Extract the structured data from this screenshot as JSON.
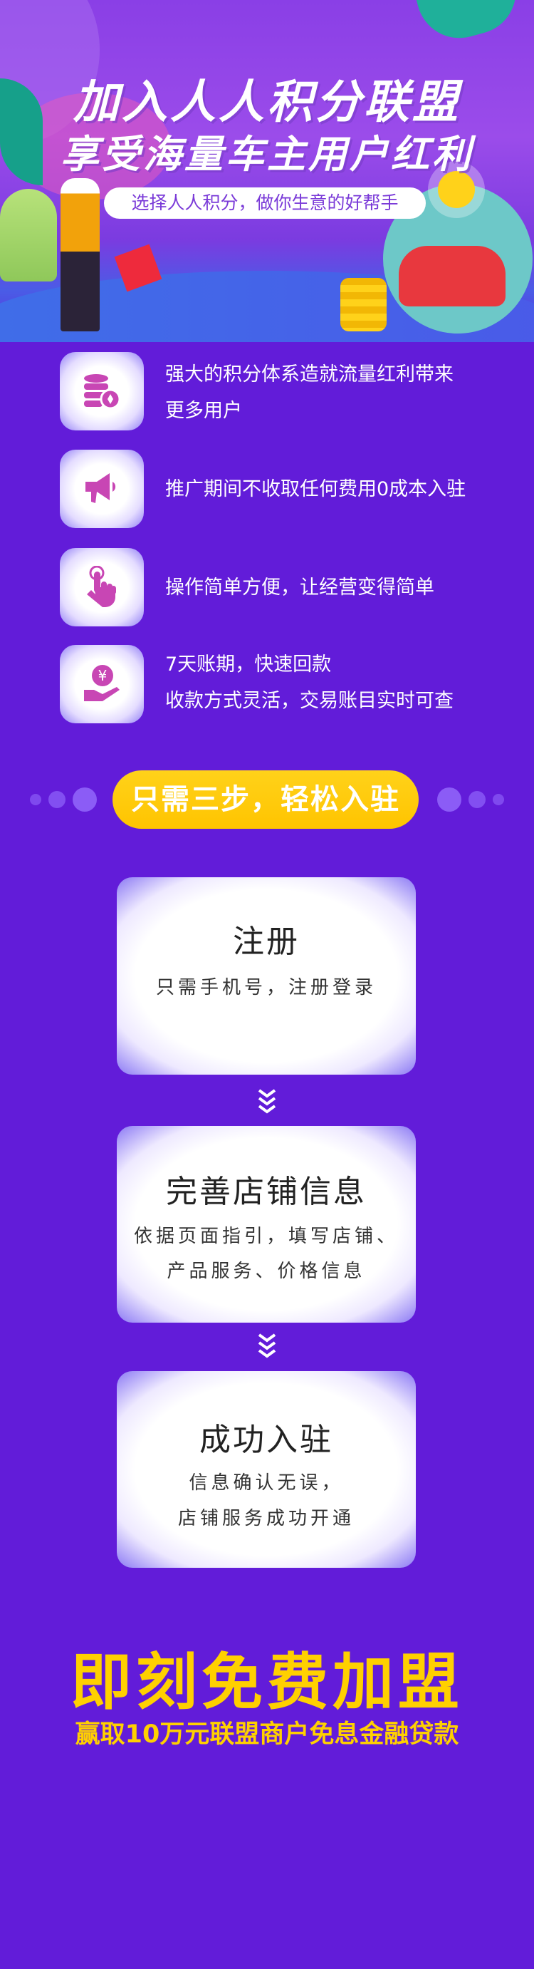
{
  "hero": {
    "title_line1": "加入人人积分联盟",
    "title_line2": "享受海量车主用户红利",
    "tagline": "选择人人积分，做你生意的好帮手"
  },
  "features": [
    {
      "icon": "coin-database-icon",
      "lines": [
        "强大的积分体系造就流量红利带来",
        "更多用户"
      ]
    },
    {
      "icon": "megaphone-icon",
      "lines": [
        "推广期间不收取任何费用0成本入驻"
      ]
    },
    {
      "icon": "tap-hand-icon",
      "lines": [
        "操作简单方便，让经营变得简单"
      ]
    },
    {
      "icon": "yuan-hand-icon",
      "lines": [
        "7天账期，快速回款",
        "收款方式灵活，交易账目实时可查"
      ]
    }
  ],
  "steps_banner": "只需三步，轻松入驻",
  "steps": [
    {
      "title": "注册",
      "lines": [
        "只需手机号，注册登录"
      ]
    },
    {
      "title": "完善店铺信息",
      "lines": [
        "依据页面指引，填写店铺、",
        "产品服务、价格信息"
      ]
    },
    {
      "title": "成功入驻",
      "lines": [
        "信息确认无误，",
        "店铺服务成功开通"
      ]
    }
  ],
  "footer": {
    "headline": "即刻免费加盟",
    "subline": "赢取10万元联盟商户免息金融贷款"
  },
  "colors": {
    "background": "#621cd9",
    "accent_yellow": "#ffd000",
    "icon_pink": "#c846b4"
  }
}
